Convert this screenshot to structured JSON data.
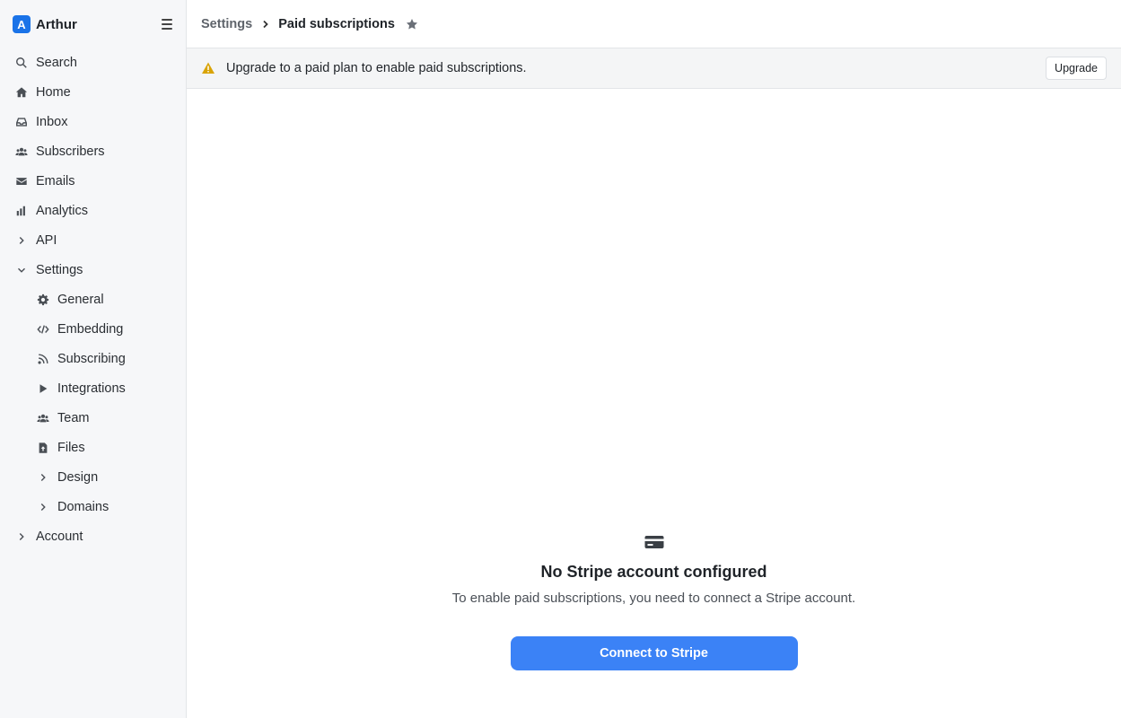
{
  "app": {
    "logo_letter": "A",
    "name": "Arthur"
  },
  "sidebar": {
    "items": [
      {
        "label": "Search"
      },
      {
        "label": "Home"
      },
      {
        "label": "Inbox"
      },
      {
        "label": "Subscribers"
      },
      {
        "label": "Emails"
      },
      {
        "label": "Analytics"
      },
      {
        "label": "API"
      },
      {
        "label": "Settings"
      },
      {
        "label": "General"
      },
      {
        "label": "Embedding"
      },
      {
        "label": "Subscribing"
      },
      {
        "label": "Integrations"
      },
      {
        "label": "Team"
      },
      {
        "label": "Files"
      },
      {
        "label": "Design"
      },
      {
        "label": "Domains"
      },
      {
        "label": "Account"
      }
    ]
  },
  "header": {
    "breadcrumb_root": "Settings",
    "breadcrumb_current": "Paid subscriptions"
  },
  "banner": {
    "message": "Upgrade to a paid plan to enable paid subscriptions.",
    "button_label": "Upgrade"
  },
  "empty_state": {
    "title": "No Stripe account configured",
    "description": "To enable paid subscriptions, you need to connect a Stripe account.",
    "button_label": "Connect to Stripe"
  },
  "colors": {
    "primary": "#3b82f6",
    "brand": "#1a73e8",
    "warning": "#d9a406"
  }
}
